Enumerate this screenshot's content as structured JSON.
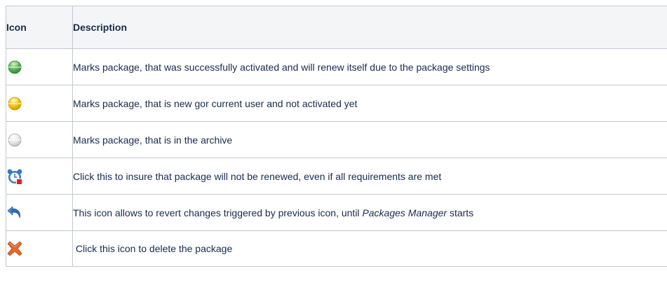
{
  "table": {
    "headers": {
      "icon": "Icon",
      "description": "Description"
    },
    "rows": [
      {
        "icon": "green-circle-icon",
        "text": "Marks package, that was successfully activated and will renew itself due to the package settings"
      },
      {
        "icon": "yellow-circle-icon",
        "text": "Marks package, that is new gor current user and not activated yet"
      },
      {
        "icon": "gray-circle-icon",
        "text": "Marks package, that is in the archive"
      },
      {
        "icon": "alarm-clock-stop-icon",
        "text": "Click this to insure that package will not be renewed, even if all requirements are met"
      },
      {
        "icon": "undo-arrow-icon",
        "text_before": "This icon allows to revert changes triggered by previous icon, until ",
        "text_em": "Packages Manager",
        "text_after": " starts"
      },
      {
        "icon": "delete-x-icon",
        "text": " Click this icon to delete the package"
      }
    ]
  },
  "colors": {
    "border": "#c1c7d0",
    "header_bg": "#f4f5f7",
    "text": "#172b4d",
    "green": "#5cb85c",
    "yellow": "#f5c518",
    "gray": "#dcdcdc",
    "blue": "#2f6fb5",
    "orange": "#e8672c",
    "red": "#e02020"
  }
}
